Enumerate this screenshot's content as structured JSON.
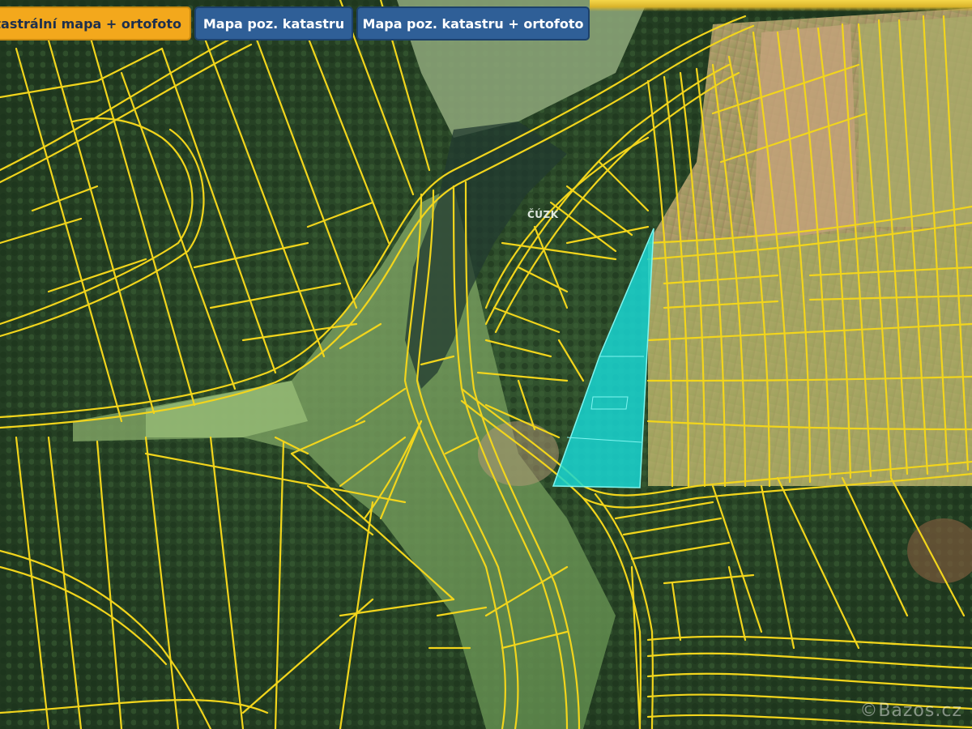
{
  "tabs": [
    {
      "label": "Katastrální mapa + ortofoto",
      "active": true
    },
    {
      "label": "Mapa poz. katastru",
      "active": false
    },
    {
      "label": "Mapa poz. katastru + ortofoto",
      "active": false
    }
  ],
  "map": {
    "attribution": "ČÚZK",
    "watermark": "©Bazos.cz",
    "colors": {
      "parcel_lines": "#f2d51c",
      "selected_parcel": "#19d6d2",
      "forest": "#2c4a2b",
      "meadow": "#6f9a5c",
      "field": "#b79a6c",
      "tab_active": "#f3a81c",
      "tab_normal": "#2f5f97"
    },
    "icons": [
      "selected-parcel-shape"
    ]
  }
}
